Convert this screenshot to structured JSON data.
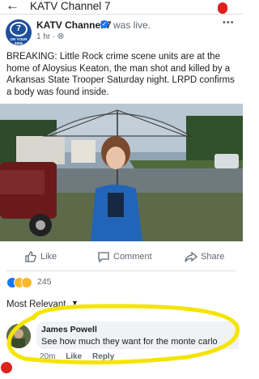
{
  "header": {
    "title": "KATV Channel 7",
    "back_icon": "back-arrow-icon"
  },
  "post": {
    "author": "KATV Channel 7",
    "status": "was live.",
    "time": "1 hr",
    "privacy_icon": "globe-icon",
    "avatar_number": "7",
    "avatar_text": "ON YOUR SIDE",
    "text": "BREAKING: Little Rock crime scene units are at the home of Aloysius Keaton, the man shot and killed by a Arkansas State Trooper Saturday night. LRPD confirms a body was found inside."
  },
  "actions": {
    "like": "Like",
    "comment": "Comment",
    "share": "Share"
  },
  "reactions": {
    "count": "245"
  },
  "comments_header": {
    "label": "Most Relevant"
  },
  "comment": {
    "author": "James Powell",
    "text": "See how much they want for the monte carlo",
    "time": "20m",
    "like": "Like",
    "reply": "Reply"
  },
  "colors": {
    "accent": "#1877f2",
    "highlight": "#f5e400",
    "notification": "#e01f1f"
  }
}
